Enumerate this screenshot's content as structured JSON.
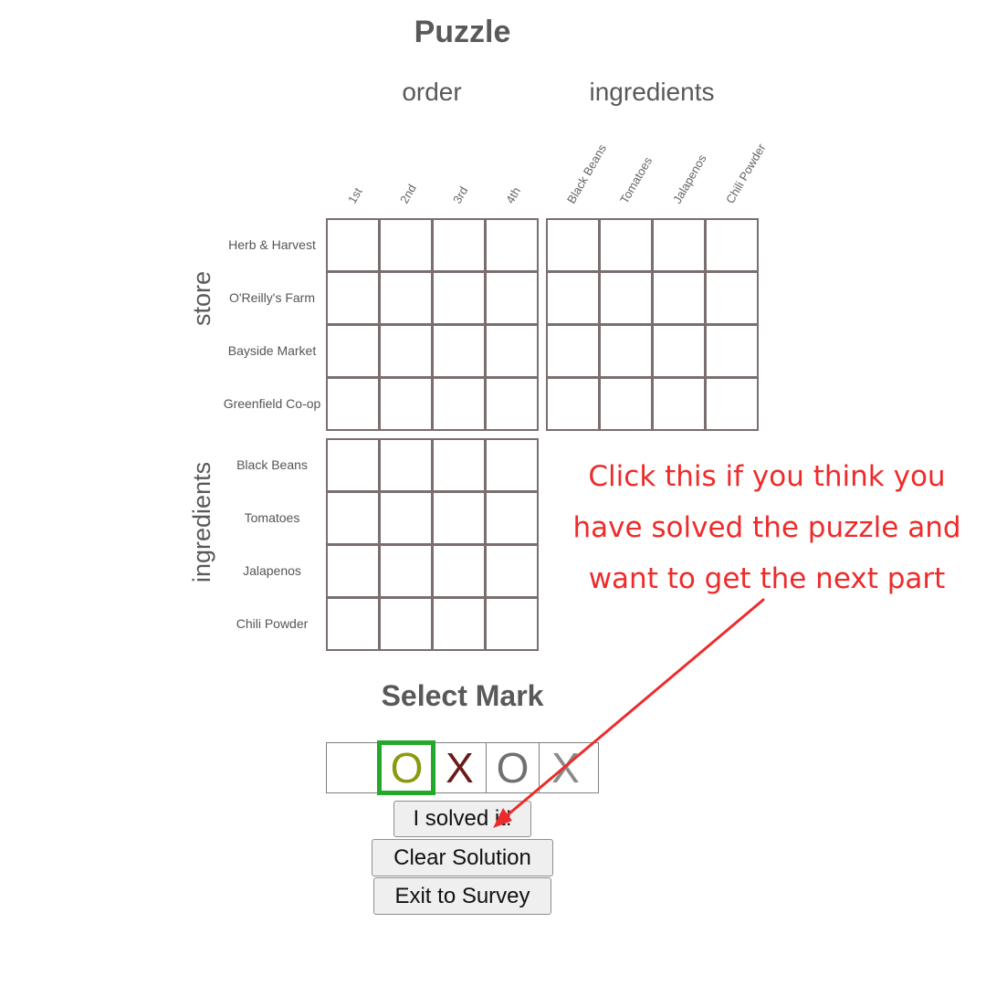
{
  "puzzle": {
    "title": "Puzzle",
    "column_groups": [
      {
        "name": "order",
        "items": [
          "1st",
          "2nd",
          "3rd",
          "4th"
        ]
      },
      {
        "name": "ingredients",
        "items": [
          "Black Beans",
          "Tomatoes",
          "Jalapenos",
          "Chili Powder"
        ]
      }
    ],
    "row_groups": [
      {
        "name": "store",
        "items": [
          "Herb & Harvest",
          "O'Reilly's Farm",
          "Bayside Market",
          "Greenfield Co-op"
        ]
      },
      {
        "name": "ingredients",
        "items": [
          "Black Beans",
          "Tomatoes",
          "Jalapenos",
          "Chili Powder"
        ]
      }
    ],
    "cell_states": "all empty"
  },
  "select_mark": {
    "title": "Select Mark",
    "marks": [
      {
        "symbol": "",
        "color": "#000000",
        "selected": false
      },
      {
        "symbol": "O",
        "color": "#8a9a10",
        "selected": true
      },
      {
        "symbol": "X",
        "color": "#6b1a1a",
        "selected": false
      },
      {
        "symbol": "O",
        "color": "#707070",
        "selected": false
      },
      {
        "symbol": "X",
        "color": "#8a8a8a",
        "selected": false
      }
    ],
    "selected_border_color": "#22a82a"
  },
  "buttons": {
    "solved": "I solved it!",
    "clear": "Clear Solution",
    "exit": "Exit to Survey"
  },
  "annotation": {
    "lines": [
      "Click this if you think you",
      "have solved the puzzle and",
      "want to get the next part"
    ],
    "color": "#ee2b2b"
  }
}
